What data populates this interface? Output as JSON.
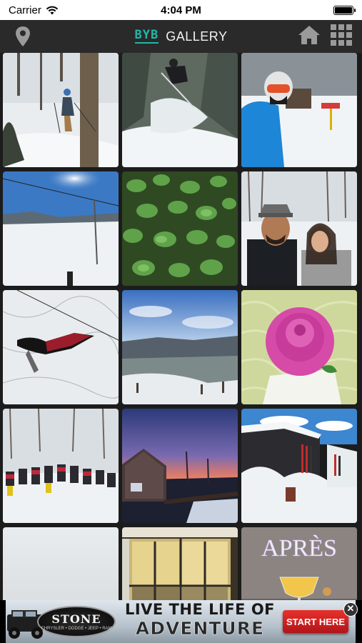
{
  "status_bar": {
    "carrier": "Carrier",
    "time": "4:04 PM",
    "wifi_icon": "wifi-icon",
    "battery_icon": "battery-icon",
    "battery_level": 1.0
  },
  "nav": {
    "location_icon": "map-pin-icon",
    "brand": "BYB",
    "title": "GALLERY",
    "home_icon": "home-icon",
    "grid_icon": "grid-menu-icon"
  },
  "gallery": {
    "photos": [
      {
        "name": "photo-skier-trees",
        "kind": "ski-trees"
      },
      {
        "name": "photo-skier-jump",
        "kind": "ski-jump"
      },
      {
        "name": "photo-skier-selfie",
        "kind": "selfie"
      },
      {
        "name": "photo-chairlift-sun",
        "kind": "lift-sun"
      },
      {
        "name": "photo-seedlings",
        "kind": "plants"
      },
      {
        "name": "photo-couple-selfie",
        "kind": "couple"
      },
      {
        "name": "photo-aerial-snow",
        "kind": "aerial"
      },
      {
        "name": "photo-valley-view",
        "kind": "valley"
      },
      {
        "name": "photo-pink-rose-cake",
        "kind": "rose"
      },
      {
        "name": "photo-ski-team",
        "kind": "team"
      },
      {
        "name": "photo-covered-bridge-sunset",
        "kind": "bridge"
      },
      {
        "name": "photo-snowy-lodge",
        "kind": "lodge"
      },
      {
        "name": "photo-overcast-sky",
        "kind": "sky"
      },
      {
        "name": "photo-window-interior",
        "kind": "window"
      },
      {
        "name": "photo-apres-drink",
        "kind": "apres"
      }
    ],
    "apres_sign": "APRÈS"
  },
  "ad": {
    "logo_name": "STONE",
    "logo_sub": "CHRYSLER • DODGE • JEEP • RAM",
    "headline_1": "LIVE THE LIFE OF",
    "headline_2": "ADVENTURE",
    "cta": "START HERE",
    "close_icon": "close-icon",
    "close_label": "✕",
    "colors": {
      "cta": "#d21f24"
    }
  },
  "colors": {
    "brand_accent": "#21b6a8",
    "nav_bg": "#2a2a2a",
    "page_bg": "#1c1c1c"
  }
}
